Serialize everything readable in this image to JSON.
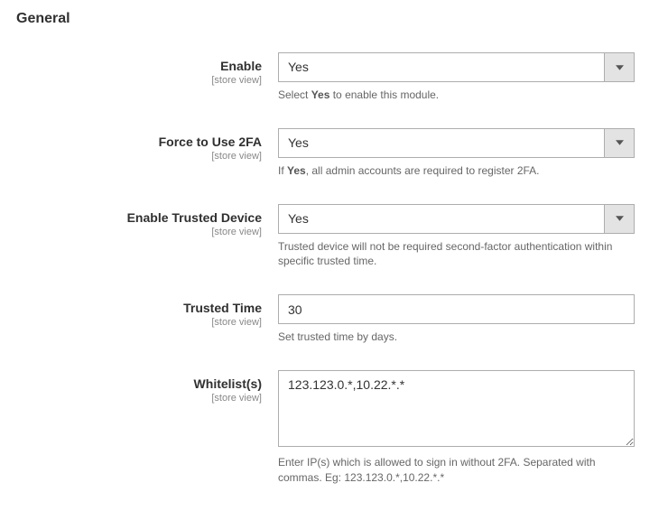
{
  "section_title": "General",
  "scope_label": "[store view]",
  "fields": {
    "enable": {
      "label": "Enable",
      "value": "Yes",
      "hint_pre": "Select ",
      "hint_bold": "Yes",
      "hint_post": " to enable this module."
    },
    "force_2fa": {
      "label": "Force to Use 2FA",
      "value": "Yes",
      "hint_pre": "If ",
      "hint_bold": "Yes",
      "hint_post": ", all admin accounts are required to register 2FA."
    },
    "trusted_device": {
      "label": "Enable Trusted Device",
      "value": "Yes",
      "hint": "Trusted device will not be required second-factor authentication within specific trusted time."
    },
    "trusted_time": {
      "label": "Trusted Time",
      "value": "30",
      "hint": "Set trusted time by days."
    },
    "whitelist": {
      "label": "Whitelist(s)",
      "value": "123.123.0.*,10.22.*.*",
      "hint": "Enter IP(s) which is allowed to sign in without 2FA. Separated with commas. Eg: 123.123.0.*,10.22.*.*"
    }
  }
}
